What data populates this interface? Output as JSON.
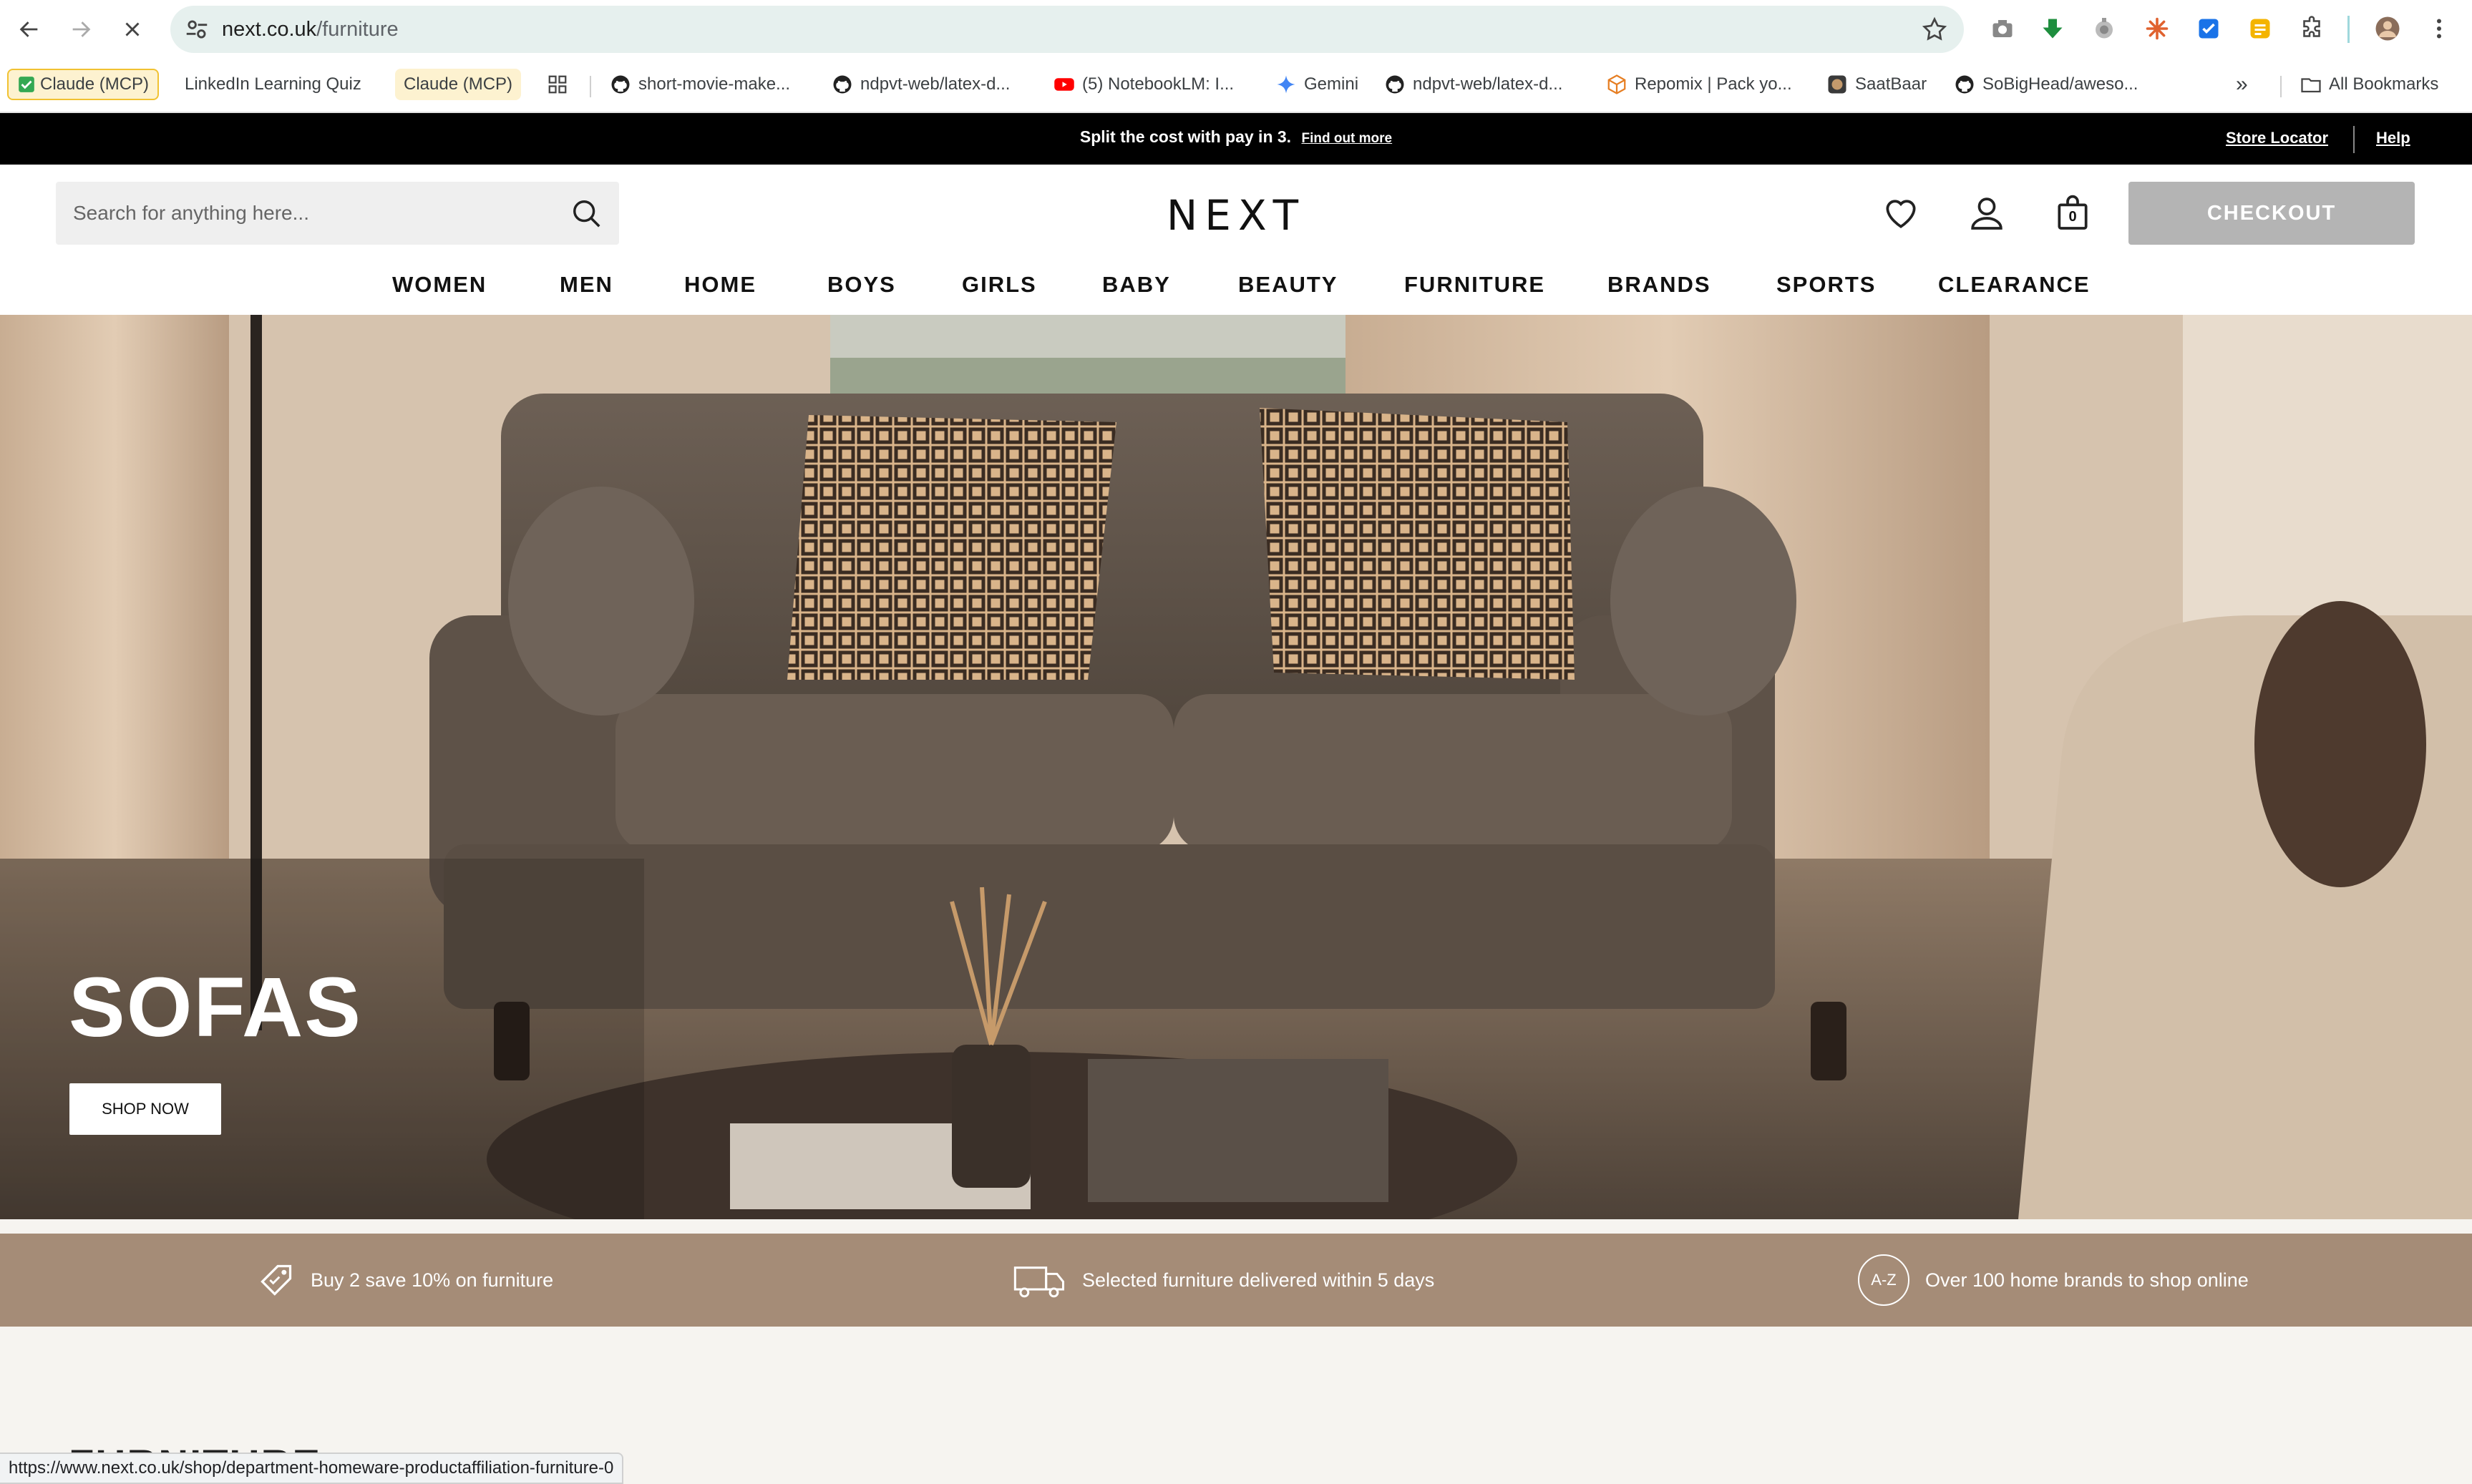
{
  "browser": {
    "url_host": "next.co.uk",
    "url_path": "/furniture",
    "status_url": "https://www.next.co.uk/shop/department-homeware-productaffiliation-furniture-0",
    "bookmarks": [
      {
        "label": "Claude (MCP)"
      },
      {
        "label": "LinkedIn Learning Quiz"
      },
      {
        "label": "Claude (MCP)"
      },
      {
        "label": "short-movie-make..."
      },
      {
        "label": "ndpvt-web/latex-d..."
      },
      {
        "label": "(5) NotebookLM: I..."
      },
      {
        "label": "Gemini"
      },
      {
        "label": "ndpvt-web/latex-d..."
      },
      {
        "label": "Repomix | Pack yo..."
      },
      {
        "label": "SaatBaar"
      },
      {
        "label": "SoBigHead/aweso..."
      }
    ],
    "all_bookmarks": "All Bookmarks",
    "overflow": "»"
  },
  "promo": {
    "text": "Split the cost with pay in 3.",
    "link": "Find out more",
    "store_locator": "Store Locator",
    "help": "Help"
  },
  "header": {
    "search_placeholder": "Search for anything here...",
    "logo": "NEXT",
    "bag_count": "0",
    "checkout": "CHECKOUT"
  },
  "nav": [
    "WOMEN",
    "MEN",
    "HOME",
    "BOYS",
    "GIRLS",
    "BABY",
    "BEAUTY",
    "FURNITURE",
    "BRANDS",
    "SPORTS",
    "CLEARANCE"
  ],
  "hero": {
    "title": "SOFAS",
    "cta": "SHOP NOW"
  },
  "usps": [
    {
      "text": "Buy 2 save 10% on furniture",
      "icon": "tag-icon"
    },
    {
      "text": "Selected furniture delivered within 5 days",
      "icon": "delivery-truck-icon"
    },
    {
      "text": "Over 100 home brands to shop online",
      "icon": "a-z-icon",
      "icon_text": "A-Z"
    }
  ],
  "section": {
    "title": "FURNITURE"
  },
  "colors": {
    "promo_bar": "#000000",
    "usp_bar": "#a58c77",
    "checkout": "#b4b4b4"
  }
}
